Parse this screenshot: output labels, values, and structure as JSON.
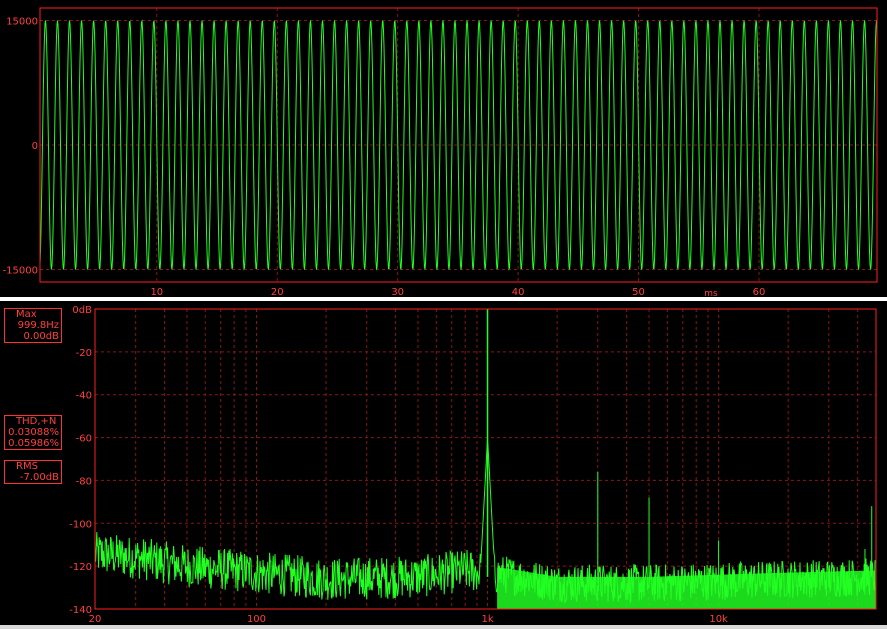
{
  "colors": {
    "trace": "#22ff22",
    "frame": "#ff2020",
    "grid": "#8a1414",
    "label": "#ff4040",
    "background": "#000000"
  },
  "waveform_panel": {
    "y_ticks": [
      "15000",
      "0",
      "-15000"
    ],
    "x_ticks": [
      "10",
      "20",
      "30",
      "40",
      "50",
      "60"
    ],
    "x_unit": "ms"
  },
  "spectrum_panel": {
    "y_ticks": [
      "0dB",
      "-20",
      "-40",
      "-60",
      "-80",
      "-100",
      "-120",
      "-140"
    ],
    "x_ticks": [
      "20",
      "100",
      "1k",
      "10k"
    ]
  },
  "readouts": {
    "max": {
      "title": "Max",
      "freq": "999.8Hz",
      "level": "0.00dB"
    },
    "thd": {
      "title": "THD,+N",
      "thd": "0.03088%",
      "thdn": "0.05986%"
    },
    "rms": {
      "title": "RMS",
      "level": "-7.00dB"
    }
  },
  "chart_data": [
    {
      "type": "line",
      "title": "",
      "xlabel": "ms",
      "ylabel": "",
      "xlim": [
        0.3,
        69.8
      ],
      "ylim": [
        -16500,
        16500
      ],
      "series": [
        {
          "frequency_hz": 999.8,
          "amplitude": 15000,
          "x_start_ms": 0.3,
          "x_end_ms": 69.8
        }
      ],
      "grid": true
    },
    {
      "type": "line",
      "title": "",
      "xlabel": "",
      "ylabel": "",
      "x_scale": "log",
      "xlim": [
        20,
        48000
      ],
      "ylim": [
        -140,
        0
      ],
      "grid": true,
      "series": [
        {
          "fundamental": {
            "x": 999.8,
            "y": 0.0
          },
          "peaks": [
            {
              "x": 1000,
              "y": -58
            },
            {
              "x": 3000,
              "y": -76
            },
            {
              "x": 5000,
              "y": -88
            },
            {
              "x": 10000,
              "y": -108
            },
            {
              "x": 46000,
              "y": -92
            },
            {
              "x": 43000,
              "y": -112
            }
          ],
          "noise_floor": [
            {
              "x": 20,
              "y": -114
            },
            {
              "x": 30,
              "y": -116
            },
            {
              "x": 50,
              "y": -120
            },
            {
              "x": 100,
              "y": -123
            },
            {
              "x": 200,
              "y": -126
            },
            {
              "x": 500,
              "y": -125
            },
            {
              "x": 800,
              "y": -122
            },
            {
              "x": 1200,
              "y": -124
            },
            {
              "x": 2000,
              "y": -128
            },
            {
              "x": 5000,
              "y": -128
            },
            {
              "x": 10000,
              "y": -127
            },
            {
              "x": 20000,
              "y": -126
            },
            {
              "x": 48000,
              "y": -125
            }
          ]
        }
      ]
    }
  ]
}
